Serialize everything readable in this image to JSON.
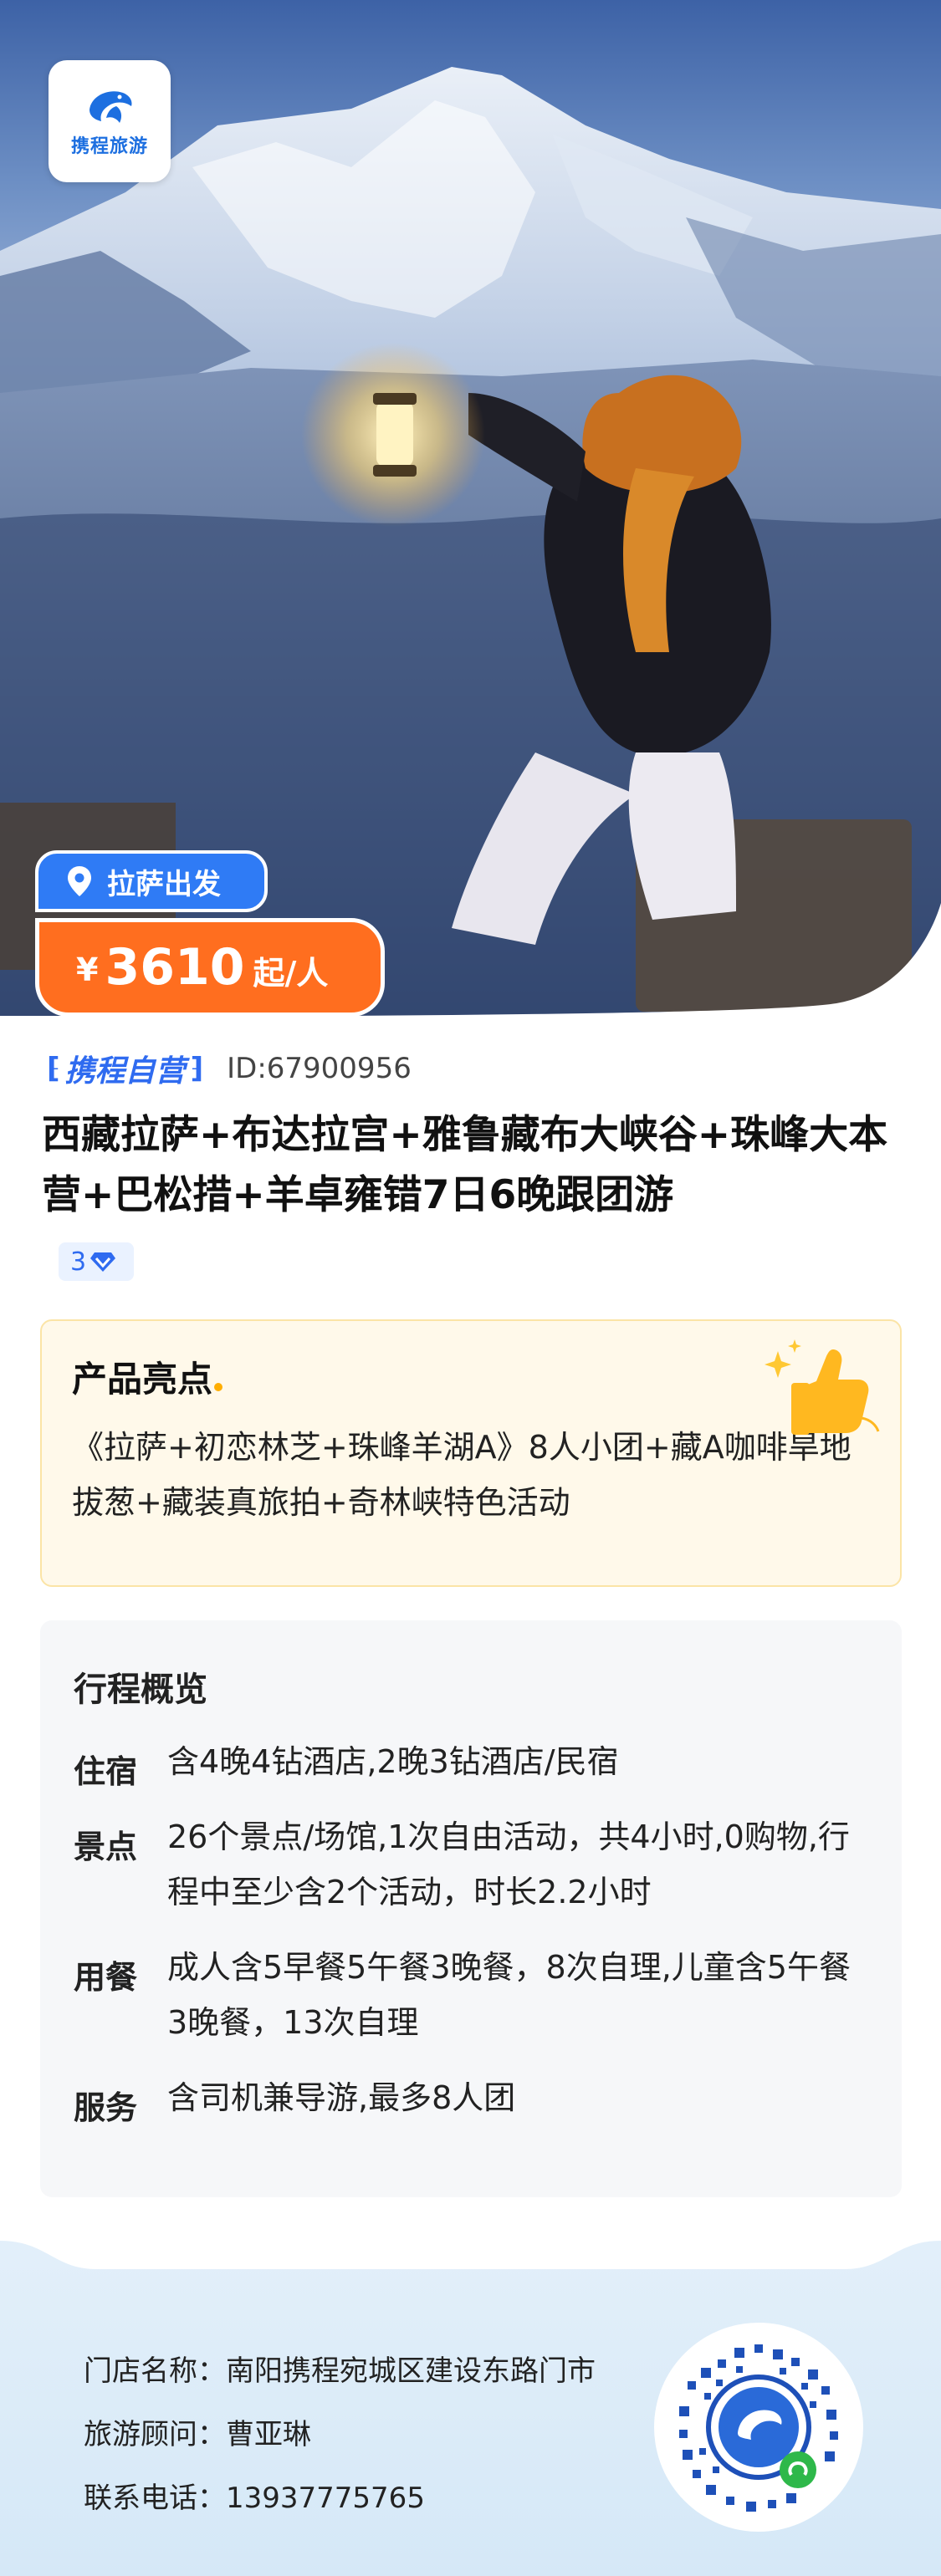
{
  "brand": {
    "logo_text": "携程旅游",
    "self_operated": "携程自营",
    "accent_blue": "#2f7bf5",
    "accent_orange": "#ff6e1f"
  },
  "location_tag": "拉萨出发",
  "price": {
    "currency": "¥",
    "amount": "3610",
    "unit": "起/人"
  },
  "product": {
    "id_text": "ID:67900956",
    "title": "西藏拉萨+布达拉宫+雅鲁藏布大峡谷+珠峰大本营+巴松措+羊卓雍错7日6晚跟团游",
    "diamond_level": "3"
  },
  "highlights": {
    "title": "产品亮点",
    "text": "《拉萨+初恋林芝+珠峰羊湖A》8人小团+藏A咖啡旱地拔葱+藏装真旅拍+奇林峡特色活动"
  },
  "itinerary": {
    "title": "行程概览",
    "rows": [
      {
        "label": "住宿",
        "value": "含4晚4钻酒店,2晚3钻酒店/民宿"
      },
      {
        "label": "景点",
        "value": "26个景点/场馆,1次自由活动，共4小时,0购物,行程中至少含2个活动，时长2.2小时"
      },
      {
        "label": "用餐",
        "value": "成人含5早餐5午餐3晚餐，8次自理,儿童含5午餐3晚餐，13次自理"
      },
      {
        "label": "服务",
        "value": "含司机兼导游,最多8人团"
      }
    ]
  },
  "store": {
    "name_label": "门店名称：",
    "name_value": "南阳携程宛城区建设东路门市",
    "advisor_label": "旅游顾问：",
    "advisor_value": "曹亚琳",
    "phone_label": "联系电话：",
    "phone_value": "13937775765"
  }
}
